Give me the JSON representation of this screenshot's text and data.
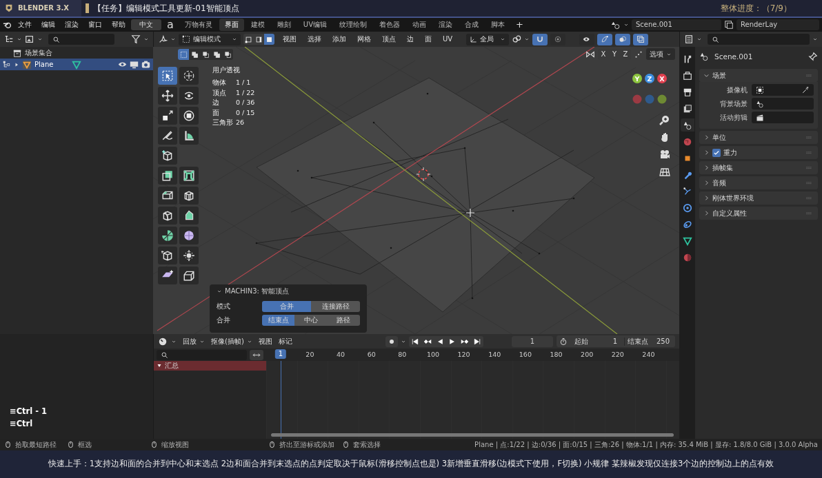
{
  "banner": {
    "app": "BLENDER 3.X",
    "title": "【任务】编辑模式工具更新-01智能顶点",
    "progress": "整体进度：（7/9）"
  },
  "topbar": {
    "menus": [
      "文件",
      "编辑",
      "渲染",
      "窗口",
      "帮助"
    ],
    "language": "中文",
    "addon": "a",
    "add": "+",
    "scene": "Scene.001",
    "view_layer": "RenderLay",
    "workspaces": [
      {
        "label": "万物有灵",
        "selected": false
      },
      {
        "label": "界面",
        "selected": true
      },
      {
        "label": "建模",
        "selected": false
      },
      {
        "label": "雕刻",
        "selected": false
      },
      {
        "label": "UV编辑",
        "selected": false
      },
      {
        "label": "纹理绘制",
        "selected": false
      },
      {
        "label": "着色器",
        "selected": false
      },
      {
        "label": "动画",
        "selected": false
      },
      {
        "label": "渲染",
        "selected": false
      },
      {
        "label": "合成",
        "selected": false
      },
      {
        "label": "脚本",
        "selected": false
      }
    ]
  },
  "outliner": {
    "collection": "场景集合",
    "items": [
      {
        "label": "Plane",
        "selected": true
      }
    ]
  },
  "viewport": {
    "mode": "编辑模式",
    "menus": [
      "视图",
      "选择",
      "添加",
      "网格",
      "顶点",
      "边",
      "面",
      "UV"
    ],
    "orientation": "全局",
    "select_modes": [
      {
        "kind": "vertex",
        "selected": false
      },
      {
        "kind": "edge",
        "selected": false
      },
      {
        "kind": "face",
        "selected": true
      }
    ],
    "toggles": [
      {
        "kind": "snap",
        "on": true
      },
      {
        "kind": "proportional",
        "on": false
      },
      {
        "kind": "visibility",
        "on": false
      },
      {
        "kind": "gizmo",
        "on": true
      },
      {
        "kind": "overlay",
        "on": true
      },
      {
        "kind": "xray",
        "on": true
      }
    ],
    "box_modes": [
      {
        "selected": true
      },
      {
        "selected": false
      },
      {
        "selected": false
      },
      {
        "selected": false
      },
      {
        "selected": false
      }
    ],
    "axes": [
      "X",
      "Y",
      "Z"
    ],
    "options": "选项",
    "view_name": "用户透视",
    "stats": [
      {
        "label": "物体",
        "value": "1 / 1"
      },
      {
        "label": "顶点",
        "value": "1 / 22"
      },
      {
        "label": "边",
        "value": "0 / 36"
      },
      {
        "label": "面",
        "value": "0 / 15"
      },
      {
        "label": "三角形",
        "value": "26"
      }
    ],
    "gizmo": [
      {
        "label": "Y",
        "color": "#8cc43f"
      },
      {
        "label": "Z",
        "color": "#3d8ee0"
      },
      {
        "label": "X",
        "color": "#e2404f"
      }
    ],
    "tools": [
      {
        "kind": "select",
        "selected": true
      },
      {
        "kind": "cursor",
        "selected": false
      },
      {
        "kind": "move",
        "selected": false
      },
      {
        "kind": "rotate",
        "selected": false
      },
      {
        "kind": "scale",
        "selected": false
      },
      {
        "kind": "transform",
        "selected": false
      },
      {
        "kind": "annotate",
        "selected": false
      },
      {
        "kind": "measure",
        "selected": false
      },
      {
        "kind": "add-cube",
        "selected": false
      },
      {
        "kind": "extrude",
        "selected": false
      },
      {
        "kind": "inset",
        "selected": false
      },
      {
        "kind": "bevel",
        "selected": false
      },
      {
        "kind": "loop-cut",
        "selected": false
      },
      {
        "kind": "knife",
        "selected": false
      },
      {
        "kind": "poly-build",
        "selected": false
      },
      {
        "kind": "spin",
        "selected": false
      },
      {
        "kind": "smooth",
        "selected": false
      },
      {
        "kind": "edge-slide",
        "selected": false
      },
      {
        "kind": "shrink",
        "selected": false
      },
      {
        "kind": "shear",
        "selected": false
      },
      {
        "kind": "rip",
        "selected": false
      }
    ]
  },
  "operator": {
    "title": "MACHIN3: 智能顶点",
    "rows": [
      {
        "label": "模式",
        "options": [
          {
            "label": "合并",
            "selected": true
          },
          {
            "label": "连接路径",
            "selected": false
          }
        ]
      },
      {
        "label": "合并",
        "options": [
          {
            "label": "结束点",
            "selected": true
          },
          {
            "label": "中心",
            "selected": false
          },
          {
            "label": "路径",
            "selected": false
          }
        ]
      }
    ]
  },
  "timeline": {
    "menus": [
      {
        "label": "回放",
        "kind": "dropdown"
      },
      {
        "label": "抠像(插帧)",
        "kind": "dropdown"
      },
      {
        "label": "视图",
        "kind": "menu"
      },
      {
        "label": "标记",
        "kind": "menu"
      }
    ],
    "current_frame": "1",
    "start_label": "起始",
    "start": "1",
    "end_label": "结束点",
    "end": "250",
    "ruler": [
      "1",
      "20",
      "40",
      "60",
      "80",
      "100",
      "120",
      "140",
      "160",
      "180",
      "200",
      "220",
      "240"
    ],
    "channels": [
      "汇总"
    ]
  },
  "properties": {
    "title": "Scene.001",
    "tabs": [
      {
        "kind": "tool",
        "selected": false
      },
      {
        "kind": "render",
        "selected": false
      },
      {
        "kind": "output",
        "selected": false
      },
      {
        "kind": "view-layer",
        "selected": false
      },
      {
        "kind": "scene",
        "selected": true
      },
      {
        "kind": "world",
        "selected": false
      },
      {
        "kind": "object",
        "selected": false
      },
      {
        "kind": "modifier",
        "selected": false
      },
      {
        "kind": "particles",
        "selected": false
      },
      {
        "kind": "physics",
        "selected": false
      },
      {
        "kind": "constraints",
        "selected": false
      },
      {
        "kind": "data",
        "selected": false
      },
      {
        "kind": "material",
        "selected": false
      }
    ],
    "panels": [
      {
        "label": "场景",
        "kind": "plain",
        "expanded": true,
        "fields": [
          {
            "label": "摄像机",
            "kind": "camera"
          },
          {
            "label": "背景场景",
            "kind": "scene"
          },
          {
            "label": "活动剪辑",
            "kind": "clip"
          }
        ]
      },
      {
        "label": "单位",
        "kind": "plain",
        "expanded": false
      },
      {
        "label": "重力",
        "kind": "checkbox",
        "checked": true,
        "expanded": false
      },
      {
        "label": "插帧集",
        "kind": "plain",
        "expanded": false
      },
      {
        "label": "音频",
        "kind": "plain",
        "expanded": false
      },
      {
        "label": "刚体世界环境",
        "kind": "plain",
        "expanded": false
      },
      {
        "label": "自定义属性",
        "kind": "plain",
        "expanded": false
      }
    ]
  },
  "keys": [
    "≡Ctrl - 1",
    "≡Ctrl"
  ],
  "status_bar": {
    "hints": [
      "拾取最短路径",
      "框选",
      "缩放视图",
      "挤出至游标或添加",
      "套索选择"
    ],
    "stats": "Plane | 点:1/22 | 边:0/36 | 面:0/15 | 三角:26 | 物体:1/1 | 内存: 35.4 MiB | 显存: 1.8/8.0 GiB | 3.0.0 Alpha"
  },
  "subtitle": "快速上手：1支持边和面的合并到中心和末选点 2边和面合并到末选点的点判定取决于鼠标(滑移控制点也是) 3新增垂直滑移(边模式下使用，F切换) 小规律 某辣椒发现仅连接3个边的控制边上的点有效"
}
